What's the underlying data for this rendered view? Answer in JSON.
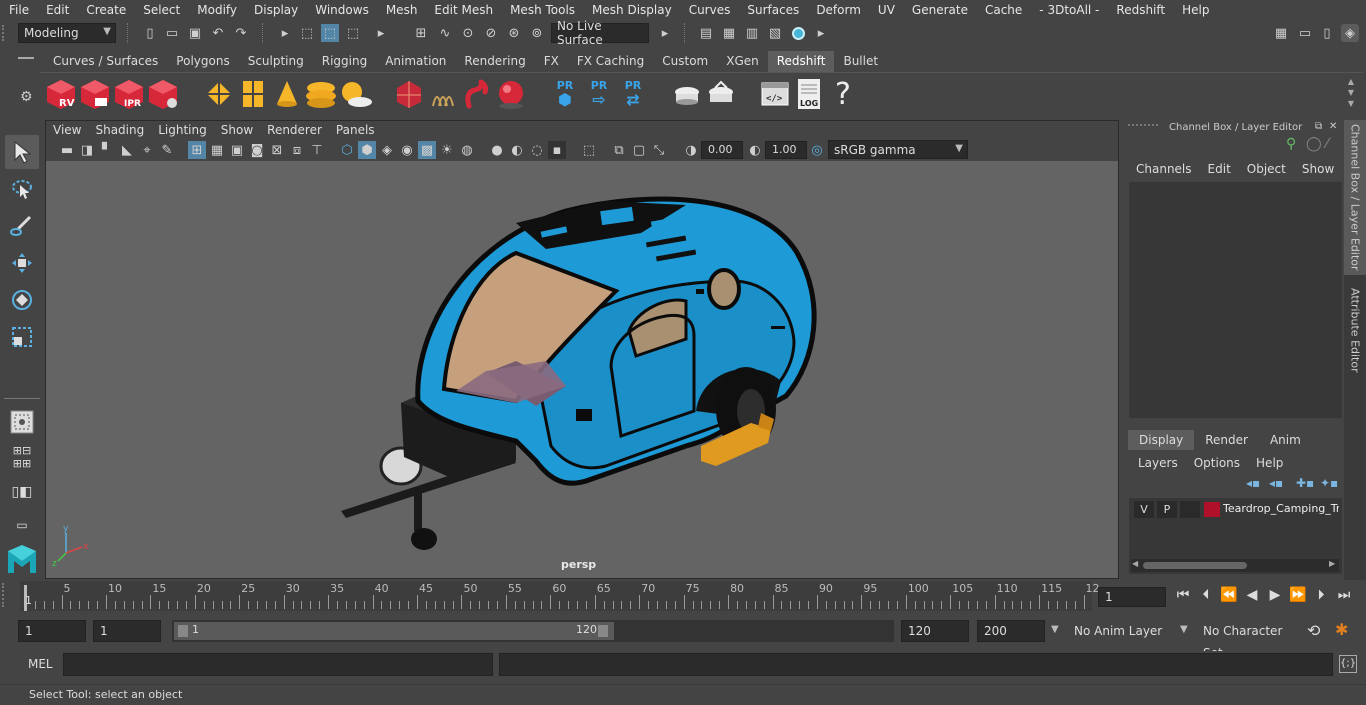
{
  "menubar": {
    "items": [
      "File",
      "Edit",
      "Create",
      "Select",
      "Modify",
      "Display",
      "Windows",
      "Mesh",
      "Edit Mesh",
      "Mesh Tools",
      "Mesh Display",
      "Curves",
      "Surfaces",
      "Deform",
      "UV",
      "Generate",
      "Cache",
      "- 3DtoAll -",
      "Redshift",
      "Help"
    ]
  },
  "statusline": {
    "mode": "Modeling",
    "live_surface": "No Live Surface"
  },
  "shelf": {
    "tabs": [
      "Curves / Surfaces",
      "Polygons",
      "Sculpting",
      "Rigging",
      "Animation",
      "Rendering",
      "FX",
      "FX Caching",
      "Custom",
      "XGen",
      "Redshift",
      "Bullet"
    ],
    "active_tab": "Redshift",
    "rv_label": "RV",
    "ipr_label": "IPR",
    "pr_label": "PR",
    "log_label": "LOG",
    "help_glyph": "?"
  },
  "viewport": {
    "menu": [
      "View",
      "Shading",
      "Lighting",
      "Show",
      "Renderer",
      "Panels"
    ],
    "exposure": "0.00",
    "gamma": "1.00",
    "color_space": "sRGB gamma",
    "camera_label": "persp"
  },
  "channelbox": {
    "title": "Channel Box / Layer Editor",
    "menu": [
      "Channels",
      "Edit",
      "Object",
      "Show"
    ],
    "layer_tabs": [
      "Display",
      "Render",
      "Anim"
    ],
    "active_layer_tab": "Display",
    "layer_menu": [
      "Layers",
      "Options",
      "Help"
    ],
    "layer": {
      "v": "V",
      "p": "P",
      "name": "Teardrop_Camping_Tra",
      "color": "#b0102a"
    }
  },
  "sidetabs": {
    "channel_box": "Channel Box / Layer Editor",
    "attribute_editor": "Attribute Editor"
  },
  "timeline": {
    "start_label": "1",
    "ticks": [
      "5",
      "10",
      "15",
      "20",
      "25",
      "30",
      "35",
      "40",
      "45",
      "50",
      "55",
      "60",
      "65",
      "70",
      "75",
      "80",
      "85",
      "90",
      "95",
      "100",
      "105",
      "110",
      "115",
      "12"
    ],
    "current_frame": "1"
  },
  "range": {
    "start": "1",
    "anim_start": "1",
    "slider_start": "1",
    "slider_end": "120",
    "end": "120",
    "anim_end": "200",
    "anim_layer": "No Anim Layer",
    "character_set": "No Character Set"
  },
  "cmdline": {
    "label": "MEL"
  },
  "helpline": {
    "text": "Select Tool: select an object"
  },
  "colors": {
    "trailer_blue": "#1e9ad6",
    "accent_highlight": "#5285a6"
  }
}
